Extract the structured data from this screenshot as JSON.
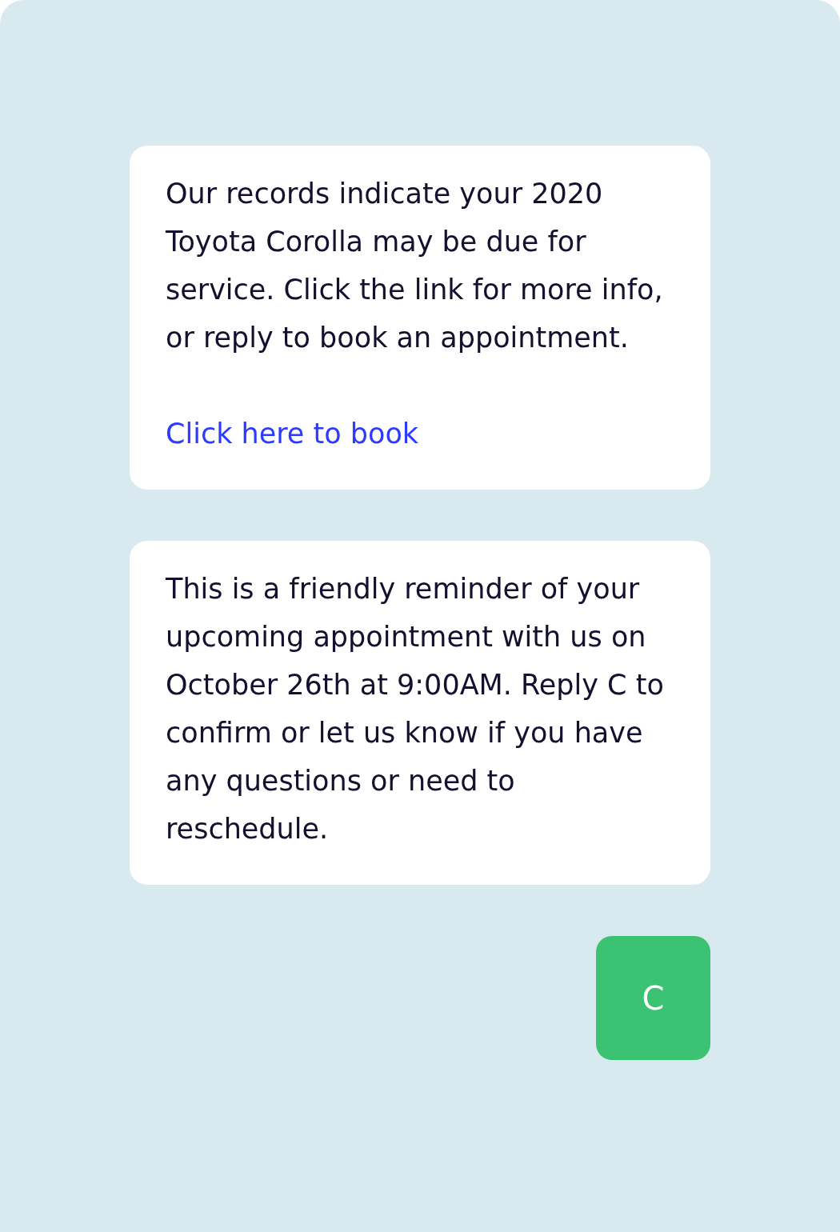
{
  "messages": [
    {
      "kind": "received",
      "text": "Our records indicate your 2020 Toyota Corolla may be due for service. Click the link for more info, or reply to book an appointment.",
      "link": "Click here to book"
    },
    {
      "kind": "received",
      "text": "This is a friendly reminder of your upcoming appointment with us on October 26th at 9:00AM. Reply C to confirm or let us know if you have any questions or need to reschedule."
    },
    {
      "kind": "sent",
      "text": "C"
    }
  ]
}
